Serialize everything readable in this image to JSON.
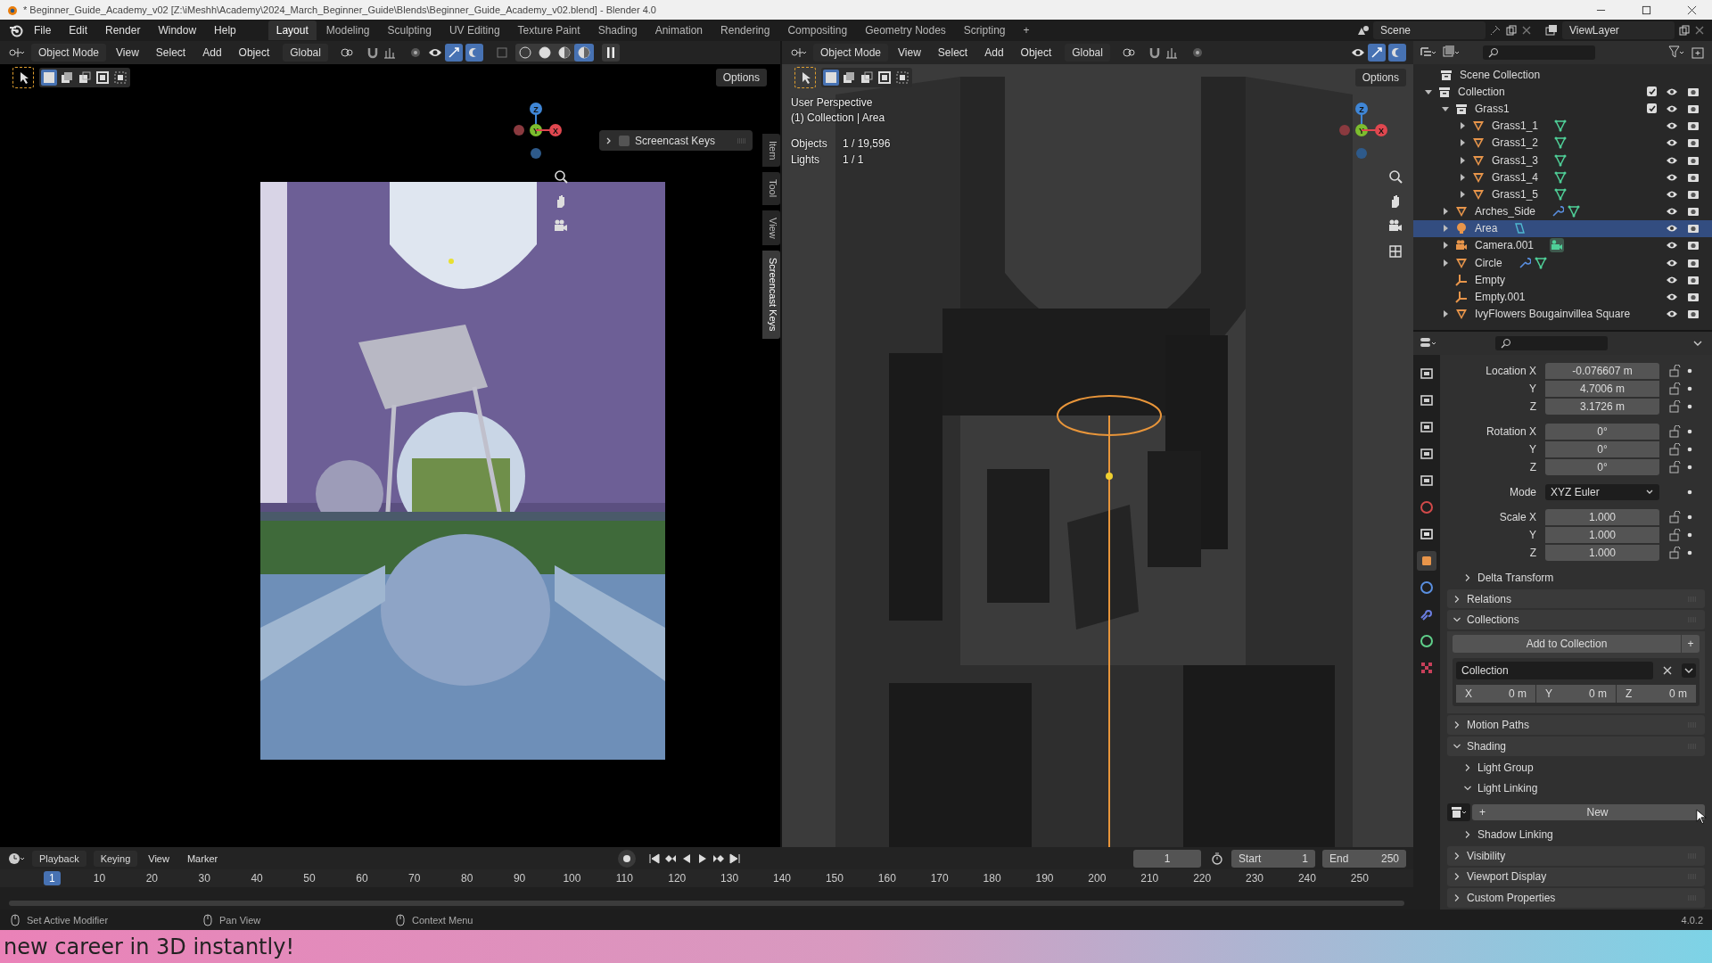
{
  "title_bar": {
    "title": "* Beginner_Guide_Academy_v02 [Z:\\iMeshh\\Academy\\2024_March_Beginner_Guide\\Blends\\Beginner_Guide_Academy_v02.blend] - Blender 4.0"
  },
  "top_bar": {
    "menus": [
      "File",
      "Edit",
      "Render",
      "Window",
      "Help"
    ],
    "workspaces": [
      {
        "label": "Layout",
        "selected": true
      },
      {
        "label": "Modeling",
        "selected": false
      },
      {
        "label": "Sculpting",
        "selected": false
      },
      {
        "label": "UV Editing",
        "selected": false
      },
      {
        "label": "Texture Paint",
        "selected": false
      },
      {
        "label": "Shading",
        "selected": false
      },
      {
        "label": "Animation",
        "selected": false
      },
      {
        "label": "Rendering",
        "selected": false
      },
      {
        "label": "Compositing",
        "selected": false
      },
      {
        "label": "Geometry Nodes",
        "selected": false
      },
      {
        "label": "Scripting",
        "selected": false
      }
    ],
    "add_workspace": "+",
    "scene": "Scene",
    "view_layer": "ViewLayer"
  },
  "viewports": [
    {
      "kind": "render",
      "mode": "Object Mode",
      "menus": [
        "View",
        "Select",
        "Add",
        "Object"
      ],
      "orientation": "Global",
      "options": "Options",
      "shading_modes": [
        {
          "selected": false
        },
        {
          "selected": false
        },
        {
          "selected": false
        },
        {
          "selected": true
        }
      ],
      "panel": {
        "title": "Screencast Keys",
        "expanded": false,
        "checked": false
      },
      "sidebar_tabs": [
        {
          "label": "Item",
          "selected": false
        },
        {
          "label": "Tool",
          "selected": false
        },
        {
          "label": "View",
          "selected": false
        },
        {
          "label": "Screencast Keys",
          "selected": true
        }
      ],
      "gizmo": [
        "X",
        "Y",
        "Z"
      ]
    },
    {
      "kind": "wireframe",
      "mode": "Object Mode",
      "menus": [
        "View",
        "Select",
        "Add",
        "Object"
      ],
      "orientation": "Global",
      "options": "Options",
      "overlay": {
        "view": "User Perspective",
        "context": "(1) Collection | Area",
        "stats": [
          {
            "label": "Objects",
            "value": "1 / 19,596"
          },
          {
            "label": "Lights",
            "value": "1 / 1"
          }
        ]
      },
      "gizmo": [
        "X",
        "Y",
        "Z"
      ]
    }
  ],
  "outliner": {
    "root": "Scene Collection",
    "items": [
      {
        "label": "Collection",
        "kind": "collection",
        "expanded": true,
        "checked": true,
        "selected": false,
        "children": [
          {
            "label": "Grass1",
            "kind": "collection",
            "expanded": true,
            "checked": true,
            "selected": false,
            "children": [
              {
                "label": "Grass1_1",
                "kind": "mesh",
                "expanded": false,
                "selected": false,
                "modifier": false,
                "data": {
                  "kind": "mesh"
                }
              },
              {
                "label": "Grass1_2",
                "kind": "mesh",
                "expanded": false,
                "selected": false,
                "modifier": false,
                "data": {
                  "kind": "mesh"
                }
              },
              {
                "label": "Grass1_3",
                "kind": "mesh",
                "expanded": false,
                "selected": false,
                "modifier": false,
                "data": {
                  "kind": "mesh"
                }
              },
              {
                "label": "Grass1_4",
                "kind": "mesh",
                "expanded": false,
                "selected": false,
                "modifier": false,
                "data": {
                  "kind": "mesh"
                }
              },
              {
                "label": "Grass1_5",
                "kind": "mesh",
                "expanded": false,
                "selected": false,
                "modifier": false,
                "data": {
                  "kind": "mesh"
                }
              }
            ]
          },
          {
            "label": "Arches_Side",
            "kind": "mesh",
            "expanded": false,
            "selected": false,
            "modifier": true,
            "data": {
              "kind": "mesh"
            }
          },
          {
            "label": "Area",
            "kind": "light",
            "expanded": false,
            "selected": true,
            "modifier": false,
            "data": {
              "kind": "light"
            }
          },
          {
            "label": "Camera.001",
            "kind": "camera",
            "expanded": false,
            "selected": false,
            "modifier": false,
            "data": {
              "kind": "camera"
            }
          },
          {
            "label": "Circle",
            "kind": "mesh",
            "expanded": false,
            "selected": false,
            "modifier": true,
            "data": {
              "kind": "mesh"
            }
          },
          {
            "label": "Empty",
            "kind": "empty",
            "selected": false,
            "modifier": false
          },
          {
            "label": "Empty.001",
            "kind": "empty",
            "selected": false,
            "modifier": false
          },
          {
            "label": "IvyFlowers Bougainvillea Square",
            "kind": "mesh",
            "expanded": false,
            "selected": false,
            "modifier": false
          }
        ]
      }
    ]
  },
  "properties": {
    "tabs": [
      {
        "kind": "tool",
        "selected": false
      },
      {
        "kind": "render",
        "selected": false
      },
      {
        "kind": "output",
        "selected": false
      },
      {
        "kind": "view_layer",
        "selected": false
      },
      {
        "kind": "scene",
        "selected": false
      },
      {
        "kind": "world",
        "selected": false
      },
      {
        "kind": "collection",
        "selected": false
      },
      {
        "kind": "object",
        "selected": true
      },
      {
        "kind": "physics",
        "selected": false
      },
      {
        "kind": "constraints",
        "selected": false
      },
      {
        "kind": "data",
        "selected": false
      },
      {
        "kind": "texture",
        "selected": false
      }
    ],
    "transform": [
      {
        "rows": [
          {
            "label": "Location X",
            "value": "-0.076607 m",
            "kind": "number"
          },
          {
            "label": "Y",
            "value": "4.7006 m",
            "kind": "number"
          },
          {
            "label": "Z",
            "value": "3.1726 m",
            "kind": "number"
          }
        ]
      },
      {
        "rows": [
          {
            "label": "Rotation X",
            "value": "0°",
            "kind": "number"
          },
          {
            "label": "Y",
            "value": "0°",
            "kind": "number"
          },
          {
            "label": "Z",
            "value": "0°",
            "kind": "number"
          }
        ]
      },
      {
        "rows": [
          {
            "label": "Mode",
            "value": "XYZ Euler",
            "kind": "dropdown"
          }
        ]
      },
      {
        "rows": [
          {
            "label": "Scale X",
            "value": "1.000",
            "kind": "number"
          },
          {
            "label": "Y",
            "value": "1.000",
            "kind": "number"
          },
          {
            "label": "Z",
            "value": "1.000",
            "kind": "number"
          }
        ]
      }
    ],
    "sections": [
      {
        "label": "Delta Transform",
        "kind": "subpanel",
        "expanded": false
      },
      {
        "label": "Relations",
        "kind": "panel",
        "expanded": false
      },
      {
        "label": "Collections",
        "kind": "panel",
        "expanded": true,
        "add_button": "Add to Collection",
        "add_icon": "+",
        "collection": "Collection",
        "offsets": [
          {
            "axis": "X",
            "value": "0 m"
          },
          {
            "axis": "Y",
            "value": "0 m"
          },
          {
            "axis": "Z",
            "value": "0 m"
          }
        ]
      },
      {
        "label": "Motion Paths",
        "kind": "panel",
        "expanded": false
      },
      {
        "label": "Shading",
        "kind": "panel",
        "expanded": true,
        "children": [
          {
            "label": "Light Group",
            "expanded": false
          },
          {
            "label": "Light Linking",
            "expanded": true,
            "new_button": "New",
            "new_icon": "+"
          },
          {
            "label": "Shadow Linking",
            "expanded": false
          }
        ]
      },
      {
        "label": "Visibility",
        "kind": "panel",
        "expanded": false
      },
      {
        "label": "Viewport Display",
        "kind": "panel",
        "expanded": false
      },
      {
        "label": "Custom Properties",
        "kind": "panel",
        "expanded": false
      }
    ]
  },
  "timeline": {
    "menus": [
      "Playback",
      "Keying",
      "View",
      "Marker"
    ],
    "current_frame": "1",
    "start_label": "Start",
    "start": "1",
    "end_label": "End",
    "end": "250",
    "playhead": "1",
    "ruler": [
      "10",
      "20",
      "30",
      "40",
      "50",
      "60",
      "70",
      "80",
      "90",
      "100",
      "110",
      "120",
      "130",
      "140",
      "150",
      "160",
      "170",
      "180",
      "190",
      "200",
      "210",
      "220",
      "230",
      "240",
      "250"
    ]
  },
  "status_bar": {
    "items": [
      {
        "label": "Set Active Modifier"
      },
      {
        "label": "Pan View"
      },
      {
        "label": "Context Menu"
      }
    ],
    "version": "4.0.2"
  },
  "banner": {
    "text": "new career in 3D instantly!"
  }
}
